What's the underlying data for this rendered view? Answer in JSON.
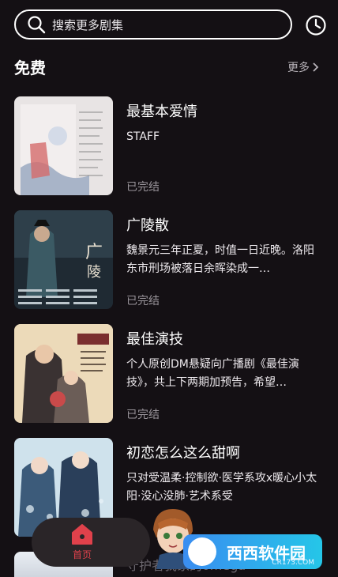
{
  "search": {
    "placeholder": "搜索更多剧集"
  },
  "section": {
    "title": "免费",
    "more_label": "更多"
  },
  "items": [
    {
      "title": "最基本爱情",
      "desc": "STAFF",
      "status": "已完结"
    },
    {
      "title": "广陵散",
      "desc": "魏景元三年正夏，时值一日近晚。洛阳东市刑场被落日余晖染成一…",
      "status": "已完结"
    },
    {
      "title": "最佳演技",
      "desc": "个人原创DM悬疑向广播剧《最佳演技》，共上下两期加预告，希望…",
      "status": "已完结"
    },
    {
      "title": "初恋怎么这么甜啊",
      "desc": "只对受温柔·控制欲·医学系攻x暖心小太阳·没心没肺·艺术系受",
      "status": ""
    }
  ],
  "partial_item": {
    "title": "守护者我家的omega"
  },
  "tabbar": {
    "home_label": "首页"
  },
  "watermark": {
    "text": "西西软件园",
    "sub": "CR173.COM"
  },
  "colors": {
    "accent": "#e0414b",
    "background": "#141014"
  }
}
